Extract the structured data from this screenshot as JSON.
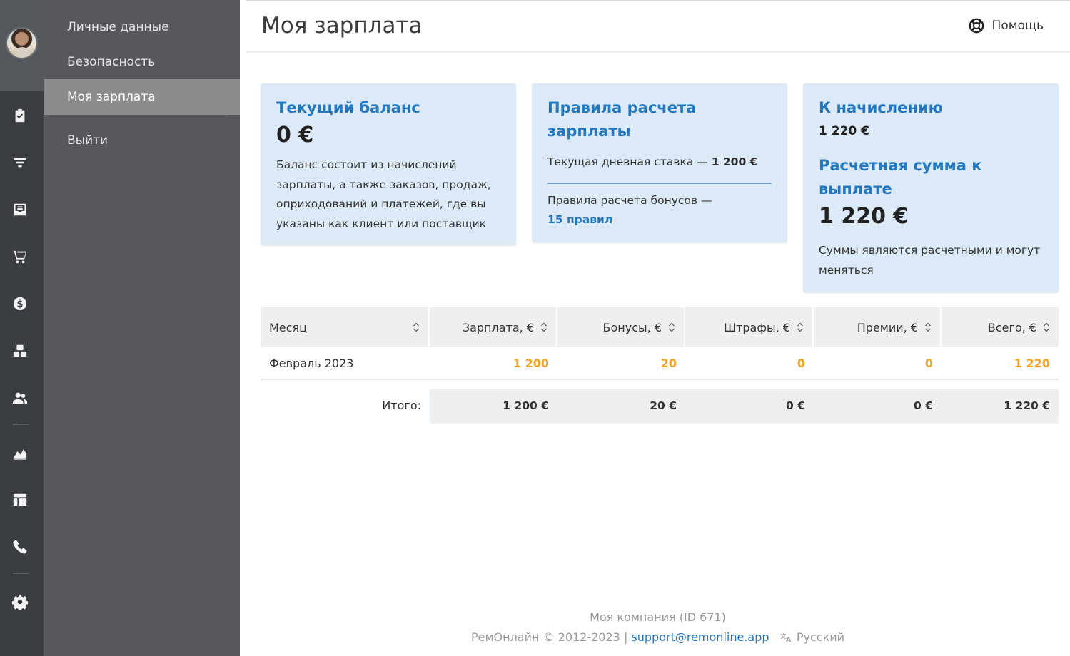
{
  "header": {
    "title": "Моя зарплата",
    "help_label": "Помощь"
  },
  "submenu": {
    "items": [
      {
        "label": "Личные данные"
      },
      {
        "label": "Безопасность"
      },
      {
        "label": "Моя зарплата",
        "active": true
      },
      {
        "label": "Выйти"
      }
    ]
  },
  "rail": {
    "icons": [
      "clipboard-check-icon",
      "filter-funnel-icon",
      "inbox-icon",
      "cart-icon",
      "dollar-icon",
      "boxes-icon",
      "users-icon",
      "chart-area-icon",
      "table-layout-icon",
      "phone-icon",
      "gear-icon"
    ]
  },
  "cards": {
    "balance": {
      "title": "Текущий баланс",
      "amount": "0 €",
      "description": "Баланс состоит из начислений зарплаты, а также заказов, продаж, оприходований и платежей, где вы указаны как клиент или поставщик"
    },
    "rules": {
      "title": "Правила расчета зарплаты",
      "daily_rate_label": "Текущая дневная ставка —",
      "daily_rate_value": "1 200 €",
      "bonus_rules_label": "Правила расчета бонусов —",
      "bonus_rules_link": "15 правил"
    },
    "accrual": {
      "title": "К начислению",
      "amount": "1 220 €",
      "estimate_title": "Расчетная сумма к выплате",
      "estimate_amount": "1 220 €",
      "note": "Суммы являются расчетными и могут меняться"
    }
  },
  "table": {
    "columns": [
      "Месяц",
      "Зарплата, €",
      "Бонусы, €",
      "Штрафы, €",
      "Премии, €",
      "Всего, €"
    ],
    "rows": [
      {
        "month": "Февраль 2023",
        "salary": "1 200",
        "bonuses": "20",
        "fines": "0",
        "premiums": "0",
        "total": "1 220"
      }
    ],
    "totals_label": "Итого:",
    "totals": {
      "salary": "1 200 €",
      "bonuses": "20 €",
      "fines": "0 €",
      "premiums": "0 €",
      "total": "1 220 €"
    }
  },
  "footer": {
    "company": "Моя компания (ID 671)",
    "copyright": "РемОнлайн © 2012-2023",
    "separator": "|",
    "email": "support@remonline.app",
    "language": "Русский"
  },
  "colors": {
    "accent": "#2378c0",
    "card_bg": "#dce9f6",
    "orange": "#f0a52b",
    "rail": "#3a3d42",
    "submenu": "#56585d"
  }
}
